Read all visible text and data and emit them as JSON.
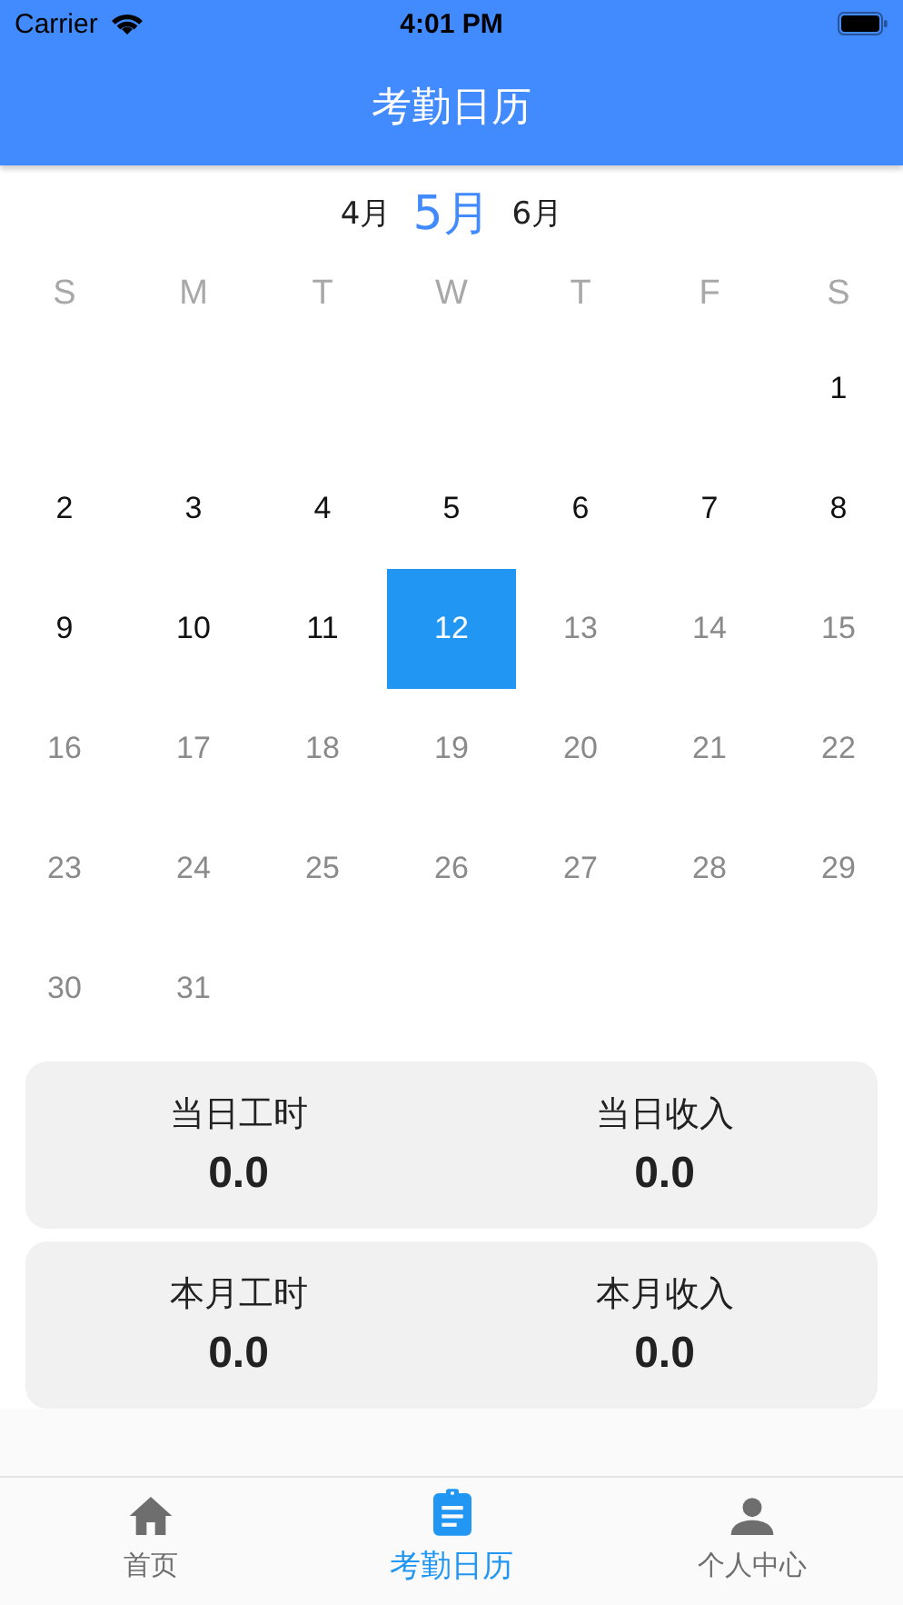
{
  "status_bar": {
    "carrier": "Carrier",
    "time": "4:01 PM"
  },
  "title": "考勤日历",
  "months": [
    {
      "label": "4月",
      "selected": false
    },
    {
      "label": "5月",
      "selected": true
    },
    {
      "label": "6月",
      "selected": false
    }
  ],
  "weekdays": [
    "S",
    "M",
    "T",
    "W",
    "T",
    "F",
    "S"
  ],
  "weeks": [
    {
      "days": [
        {
          "kind": "blank"
        },
        {
          "kind": "blank"
        },
        {
          "kind": "blank"
        },
        {
          "kind": "blank"
        },
        {
          "kind": "blank"
        },
        {
          "kind": "blank"
        },
        {
          "kind": "day",
          "label": "1",
          "selected": false,
          "muted": false
        }
      ]
    },
    {
      "days": [
        {
          "kind": "day",
          "label": "2",
          "selected": false,
          "muted": false
        },
        {
          "kind": "day",
          "label": "3",
          "selected": false,
          "muted": false
        },
        {
          "kind": "day",
          "label": "4",
          "selected": false,
          "muted": false
        },
        {
          "kind": "day",
          "label": "5",
          "selected": false,
          "muted": false
        },
        {
          "kind": "day",
          "label": "6",
          "selected": false,
          "muted": false
        },
        {
          "kind": "day",
          "label": "7",
          "selected": false,
          "muted": false
        },
        {
          "kind": "day",
          "label": "8",
          "selected": false,
          "muted": false
        }
      ]
    },
    {
      "days": [
        {
          "kind": "day",
          "label": "9",
          "selected": false,
          "muted": false
        },
        {
          "kind": "day",
          "label": "10",
          "selected": false,
          "muted": false
        },
        {
          "kind": "day",
          "label": "11",
          "selected": false,
          "muted": false
        },
        {
          "kind": "day",
          "label": "12",
          "selected": true,
          "muted": false
        },
        {
          "kind": "day",
          "label": "13",
          "selected": false,
          "muted": true
        },
        {
          "kind": "day",
          "label": "14",
          "selected": false,
          "muted": true
        },
        {
          "kind": "day",
          "label": "15",
          "selected": false,
          "muted": true
        }
      ]
    },
    {
      "days": [
        {
          "kind": "day",
          "label": "16",
          "selected": false,
          "muted": true
        },
        {
          "kind": "day",
          "label": "17",
          "selected": false,
          "muted": true
        },
        {
          "kind": "day",
          "label": "18",
          "selected": false,
          "muted": true
        },
        {
          "kind": "day",
          "label": "19",
          "selected": false,
          "muted": true
        },
        {
          "kind": "day",
          "label": "20",
          "selected": false,
          "muted": true
        },
        {
          "kind": "day",
          "label": "21",
          "selected": false,
          "muted": true
        },
        {
          "kind": "day",
          "label": "22",
          "selected": false,
          "muted": true
        }
      ]
    },
    {
      "days": [
        {
          "kind": "day",
          "label": "23",
          "selected": false,
          "muted": true
        },
        {
          "kind": "day",
          "label": "24",
          "selected": false,
          "muted": true
        },
        {
          "kind": "day",
          "label": "25",
          "selected": false,
          "muted": true
        },
        {
          "kind": "day",
          "label": "26",
          "selected": false,
          "muted": true
        },
        {
          "kind": "day",
          "label": "27",
          "selected": false,
          "muted": true
        },
        {
          "kind": "day",
          "label": "28",
          "selected": false,
          "muted": true
        },
        {
          "kind": "day",
          "label": "29",
          "selected": false,
          "muted": true
        }
      ]
    },
    {
      "days": [
        {
          "kind": "day",
          "label": "30",
          "selected": false,
          "muted": true
        },
        {
          "kind": "day",
          "label": "31",
          "selected": false,
          "muted": true
        }
      ]
    }
  ],
  "summary_cards": [
    {
      "stats": [
        {
          "label": "当日工时",
          "value": "0.0"
        },
        {
          "label": "当日收入",
          "value": "0.0"
        }
      ]
    },
    {
      "stats": [
        {
          "label": "本月工时",
          "value": "0.0"
        },
        {
          "label": "本月收入",
          "value": "0.0"
        }
      ]
    }
  ],
  "tab_bar": [
    {
      "kind": "home",
      "label": "首页",
      "selected": false
    },
    {
      "kind": "clipboard",
      "label": "考勤日历",
      "selected": true
    },
    {
      "kind": "person",
      "label": "个人中心",
      "selected": false
    }
  ]
}
